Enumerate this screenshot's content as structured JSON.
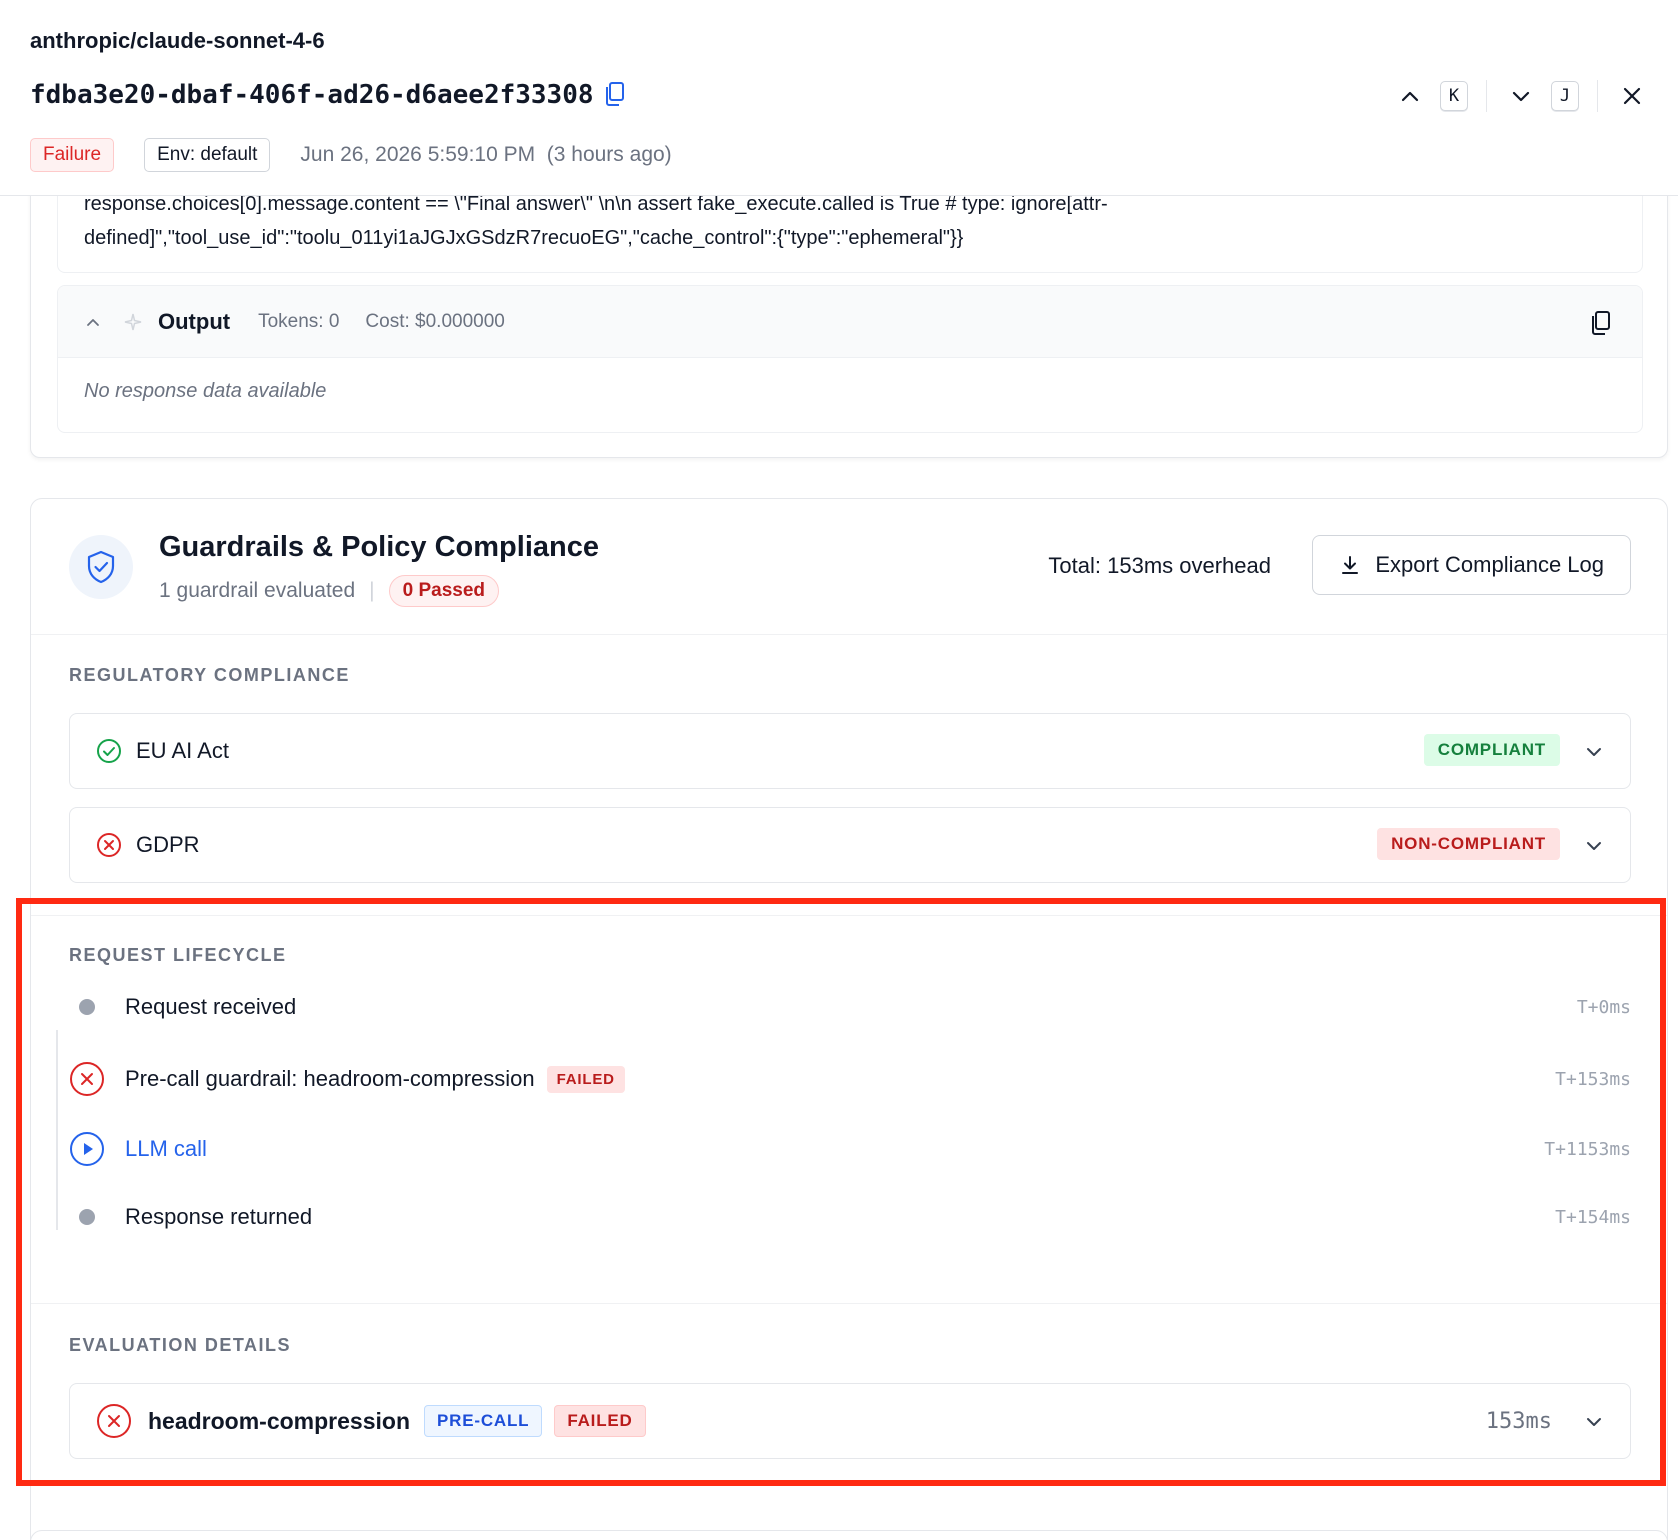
{
  "header": {
    "model_name": "anthropic/claude-sonnet-4-6",
    "trace_id": "fdba3e20-dbaf-406f-ad26-d6aee2f33308",
    "status_badge": "Failure",
    "env_badge": "Env: default",
    "timestamp": "Jun 26, 2026 5:59:10 PM",
    "relative_time": "(3 hours ago)",
    "nav": {
      "prev_key": "K",
      "next_key": "J"
    }
  },
  "input": {
    "line1": "response.choices[0].message.content == \\\"Final answer\\\" \\n\\n    assert fake_execute.called is True  # type: ignore[attr-",
    "line2": "defined]\",\"tool_use_id\":\"toolu_011yi1aJGJxGSdzR7recuoEG\",\"cache_control\":{\"type\":\"ephemeral\"}}"
  },
  "output": {
    "title": "Output",
    "tokens": "Tokens: 0",
    "cost": "Cost: $0.000000",
    "empty_message": "No response data available"
  },
  "guardrails": {
    "title": "Guardrails & Policy Compliance",
    "summary": "1 guardrail evaluated",
    "passed_badge": "0 Passed",
    "overhead": "Total: 153ms overhead",
    "export_label": "Export Compliance Log",
    "regulatory": {
      "section_label": "REGULATORY COMPLIANCE",
      "items": [
        {
          "name": "EU AI Act",
          "status": "COMPLIANT"
        },
        {
          "name": "GDPR",
          "status": "NON-COMPLIANT"
        }
      ]
    },
    "lifecycle": {
      "section_label": "REQUEST LIFECYCLE",
      "steps": [
        {
          "label": "Request received",
          "time": "T+0ms"
        },
        {
          "label": "Pre-call guardrail: headroom-compression",
          "badge": "FAILED",
          "time": "T+153ms"
        },
        {
          "label": "LLM call",
          "time": "T+1153ms"
        },
        {
          "label": "Response returned",
          "time": "T+154ms"
        }
      ]
    },
    "evaluation": {
      "section_label": "EVALUATION DETAILS",
      "items": [
        {
          "name": "headroom-compression",
          "phase": "PRE-CALL",
          "status": "FAILED",
          "duration": "153ms"
        }
      ]
    }
  },
  "colors": {
    "accent_blue": "#2563eb",
    "fail_red": "#dc2626",
    "success_green": "#16a34a",
    "highlight_red": "#ff2a12"
  }
}
